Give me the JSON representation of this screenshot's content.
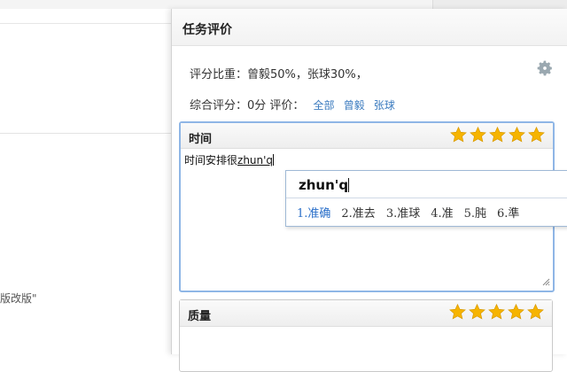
{
  "background": {
    "partial_text": "版改版\""
  },
  "panel": {
    "title": "任务评价",
    "weight_line": "评分比重：曾毅50%，张球30%，",
    "score_prefix": "综合评分：0分  评价：",
    "filters": [
      "全部",
      "曾毅",
      "张球"
    ]
  },
  "sections": [
    {
      "title": "时间",
      "rating": 5,
      "rating_max": 5,
      "text_committed": "时间安排很",
      "text_composing": "zhun'q"
    },
    {
      "title": "质量",
      "rating": 5,
      "rating_max": 5
    }
  ],
  "ime": {
    "input": "zhun'q",
    "candidates": [
      "1.准确",
      "2.准去",
      "3.准球",
      "4.准",
      "5.肫",
      "6.準"
    ],
    "selected_index": 0
  },
  "colors": {
    "star": "#f6b400",
    "link": "#3b7bbf",
    "active_border": "#8fb6e6",
    "gear": "#9aa8b0"
  },
  "icons": {
    "settings": "gear-icon",
    "rating": "star-icon"
  }
}
